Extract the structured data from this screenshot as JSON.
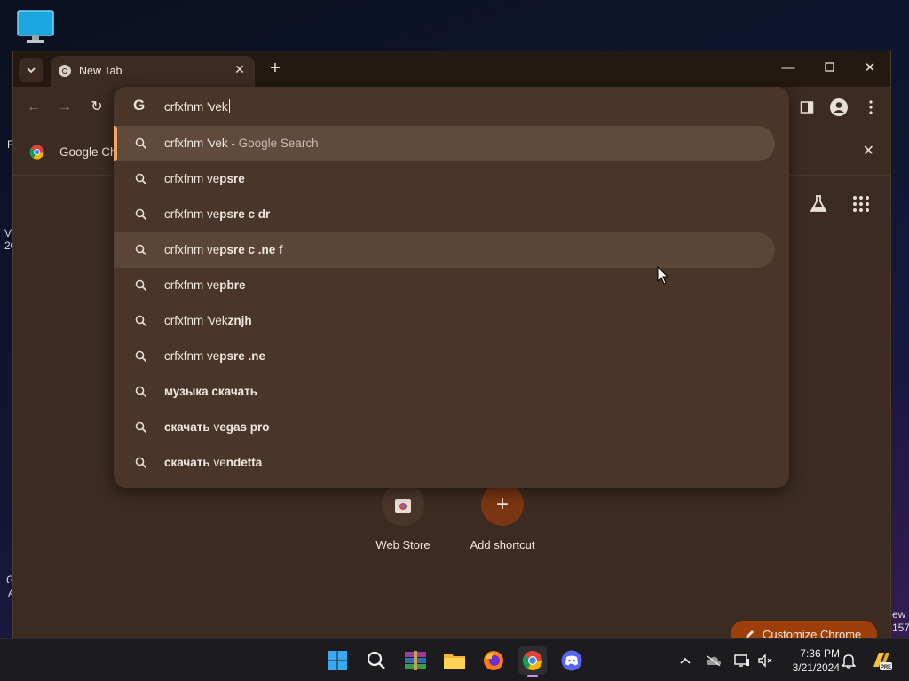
{
  "desktop": {
    "edge_left": [
      "R",
      "Vi",
      "20",
      "G",
      "A"
    ],
    "edge_right": [
      "ew",
      "157"
    ]
  },
  "browser": {
    "tab_title": "New Tab",
    "bookmark_label": "Google Ch",
    "omnibox_value": "crfxfnm 'vek",
    "suggestions": [
      {
        "prefix": "crfxfnm 'vek",
        "bold": "",
        "suffix": " - Google Search",
        "state": "selected"
      },
      {
        "prefix": "crfxfnm ve",
        "bold": "psre",
        "suffix": "",
        "state": ""
      },
      {
        "prefix": "crfxfnm ve",
        "bold": "psre c dr",
        "suffix": "",
        "state": ""
      },
      {
        "prefix": "crfxfnm ve",
        "bold": "psre c .ne f",
        "suffix": "",
        "state": "hovered"
      },
      {
        "prefix": "crfxfnm ve",
        "bold": "pbre",
        "suffix": "",
        "state": ""
      },
      {
        "prefix": "crfxfnm 'vek",
        "bold": "znjh",
        "suffix": "",
        "state": ""
      },
      {
        "prefix": "crfxfnm ve",
        "bold": "psre .ne",
        "suffix": "",
        "state": ""
      },
      {
        "prefix": "",
        "bold": "музыка скачать",
        "suffix": "",
        "state": ""
      },
      {
        "prefix": "",
        "bold": "скачать ",
        "suffix": "",
        "state": "",
        "mid": "v",
        "tail_bold": "egas pro"
      },
      {
        "prefix": "",
        "bold": "скачать ",
        "suffix": "",
        "state": "",
        "mid": "ve",
        "tail_bold": "ndetta"
      }
    ],
    "shortcuts": [
      {
        "label": "Web Store"
      },
      {
        "label": "Add shortcut"
      }
    ],
    "customize_label": "Customize Chrome"
  },
  "taskbar": {
    "time": "7:36 PM",
    "date": "3/21/2024"
  },
  "colors": {
    "accent": "#f2a46a",
    "surface": "#3b2b21",
    "omnibox": "#4a3629",
    "customize": "#9c3f0a"
  }
}
